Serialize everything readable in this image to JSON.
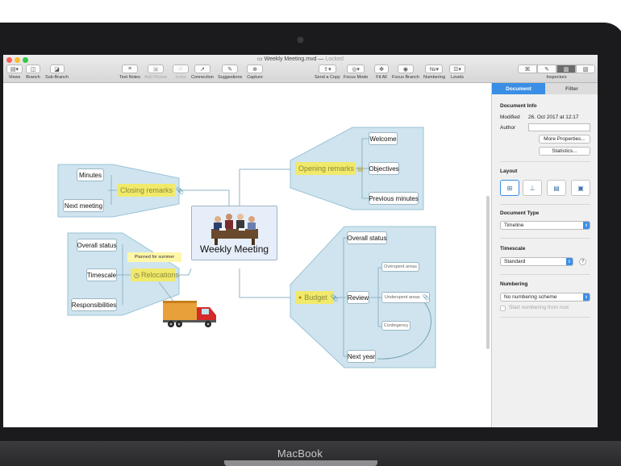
{
  "device": {
    "brand": "MacBook"
  },
  "window": {
    "title": "Weekly Meeting.mvd",
    "title_separator": "—",
    "locked_label": "Locked",
    "traffic_colors": [
      "#fc5f57",
      "#fdbc2e",
      "#33c748"
    ]
  },
  "toolbar": {
    "views": "Views",
    "branch": "Branch",
    "sub_branch": "Sub-Branch",
    "text_notes": "Text Notes",
    "add_picture": "Add Picture",
    "icons": "Icons",
    "connection": "Connection",
    "suggestions": "Suggestions",
    "capture": "Capture",
    "send_a_copy": "Send a Copy",
    "focus_mode": "Focus Mode",
    "fit_all": "Fit All",
    "focus_branch": "Focus Branch",
    "numbering": "Numbering",
    "levels": "Levels",
    "inspectors": "Inspectors"
  },
  "mindmap": {
    "central_topic": "Weekly Meeting",
    "branches": {
      "opening": {
        "label": "Opening remarks",
        "children": [
          "Welcome",
          "Objectives",
          "Previous minutes"
        ]
      },
      "closing": {
        "label": "Closing remarks",
        "children": [
          "Minutes",
          "Next meeting"
        ]
      },
      "relocations": {
        "label": "Relocations",
        "note": "Planned for summer",
        "children": [
          "Overall status",
          "Timescale",
          "Responsibilities"
        ]
      },
      "budget": {
        "label": "Budget",
        "children": [
          "Overall status",
          "Review",
          "Next year"
        ],
        "review_children": [
          "Overspent areas",
          "Underspent areas",
          "Contingency"
        ]
      }
    },
    "colors": {
      "branch_fill": "#cfe4ef",
      "highlight": "#f1e96a",
      "line": "#8fb3c6"
    }
  },
  "inspector": {
    "tabs": {
      "document": "Document",
      "filter": "Filter"
    },
    "document_info": {
      "heading": "Document Info",
      "modified_label": "Modified",
      "modified_value": "26. Oct 2017 at 12:17",
      "author_label": "Author",
      "author_value": "",
      "more_properties": "More Properties...",
      "statistics": "Statistics..."
    },
    "layout": {
      "heading": "Layout"
    },
    "document_type": {
      "heading": "Document Type",
      "value": "Timeline"
    },
    "timescale": {
      "heading": "Timescale",
      "value": "Standard",
      "help": "?"
    },
    "numbering": {
      "heading": "Numbering",
      "value": "No numbering scheme",
      "start_from_root": "Start numbering from root"
    },
    "accent": "#3b8ee5"
  }
}
